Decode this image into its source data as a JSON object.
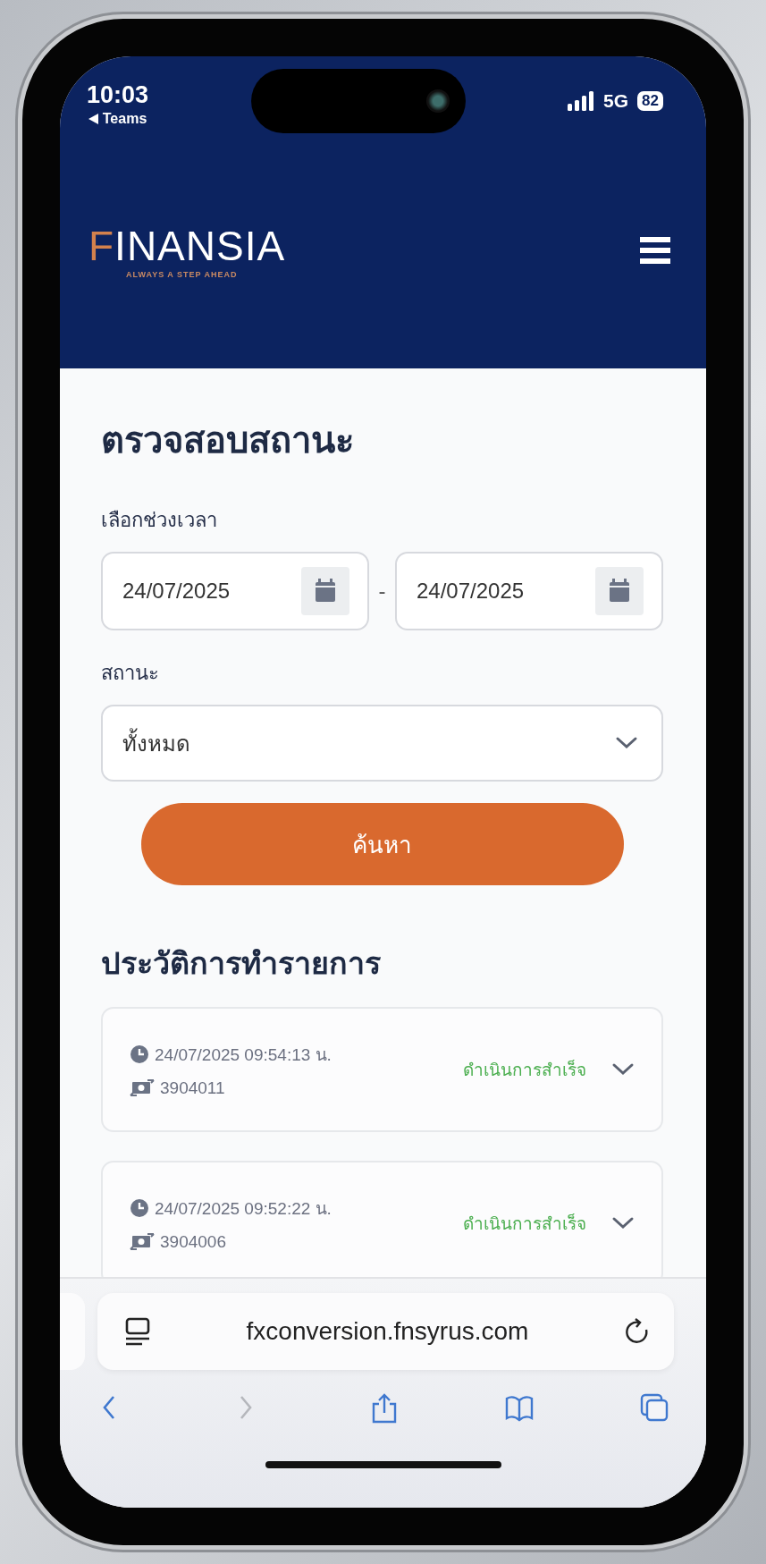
{
  "status_bar": {
    "time": "10:03",
    "back_app": "Teams",
    "network": "5G",
    "battery": "82"
  },
  "header": {
    "logo": "FINANSIA",
    "tagline": "ALWAYS A STEP AHEAD"
  },
  "page_title": "ตรวจสอบสถานะ",
  "date_range": {
    "label": "เลือกช่วงเวลา",
    "start": "24/07/2025",
    "separator": "-",
    "end": "24/07/2025"
  },
  "status_filter": {
    "label": "สถานะ",
    "value": "ทั้งหมด"
  },
  "search_button": "ค้นหา",
  "history": {
    "title": "ประวัติการทำรายการ",
    "transactions": [
      {
        "datetime": "24/07/2025 09:54:13 น.",
        "reference": "3904011",
        "status": "ดำเนินการสำเร็จ"
      },
      {
        "datetime": "24/07/2025 09:52:22 น.",
        "reference": "3904006",
        "status": "ดำเนินการสำเร็จ"
      }
    ]
  },
  "browser": {
    "url": "fxconversion.fnsyrus.com",
    "toolbar": [
      {
        "kind": "back",
        "disabled": false
      },
      {
        "kind": "forward",
        "disabled": true
      },
      {
        "kind": "share",
        "disabled": false
      },
      {
        "kind": "bookmarks",
        "disabled": false
      },
      {
        "kind": "tabs",
        "disabled": false
      }
    ]
  }
}
